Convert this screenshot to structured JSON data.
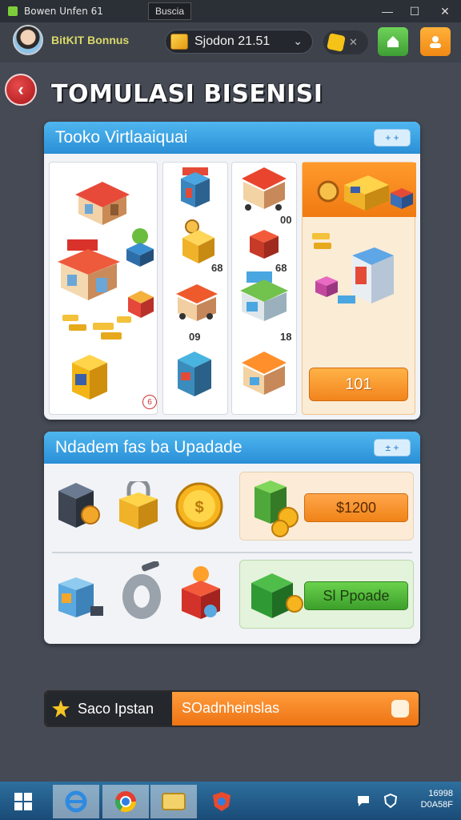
{
  "window": {
    "title": "Bowen Unfen 61",
    "tab_label": "Buscia",
    "minimize": "—",
    "maximize": "☐",
    "close": "✕"
  },
  "header": {
    "player_name": "BitKIT Bonnus",
    "station_label": "Sjodon 21.51",
    "puzzle_label": "✕"
  },
  "page": {
    "title": "TOMULASI BISENISI",
    "back_icon": "‹"
  },
  "shop": {
    "title": "Tooko Virtlaaiquai",
    "header_button": "+ +",
    "prices": [
      "68",
      "00",
      "68",
      "09",
      "18"
    ],
    "badge": "6",
    "buy_button": "101"
  },
  "upgrades": {
    "title": "Ndadem fas ba Upadade",
    "header_button": "± +",
    "offer1_button": "$1200",
    "offer2_button": "Sl Ppoade"
  },
  "bottom_bar": {
    "left_label": "Saco Ipstan",
    "right_label": "SOadnheinslas"
  },
  "taskbar": {
    "time": "16998",
    "date": "D0A58F"
  },
  "colors": {
    "accent_blue": "#2a8fd6",
    "accent_orange": "#f08914",
    "accent_green": "#3e9e34"
  }
}
